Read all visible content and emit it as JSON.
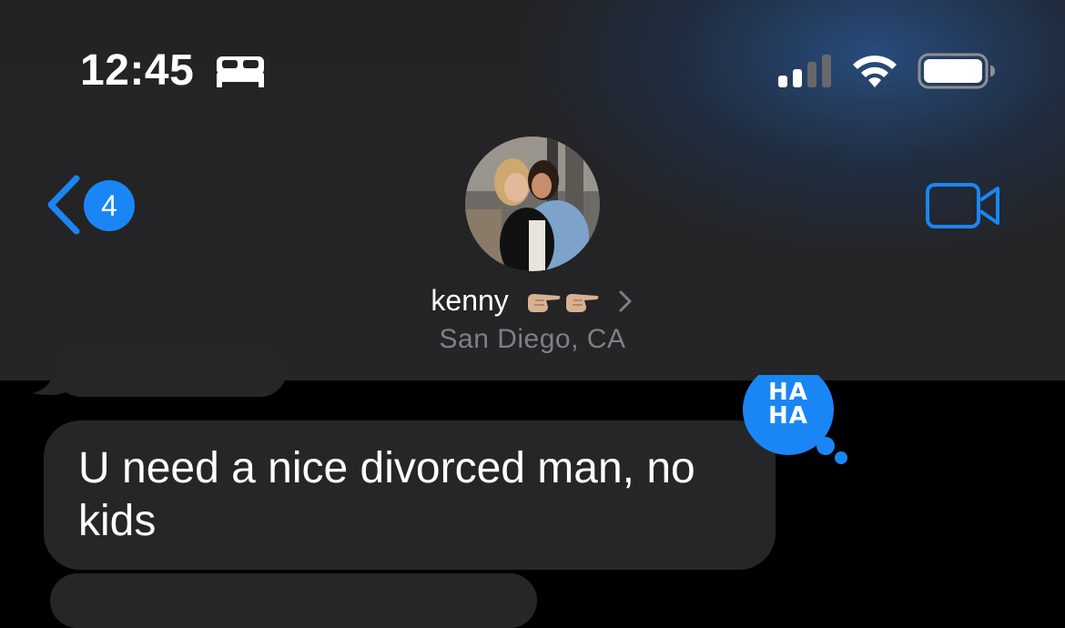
{
  "status_bar": {
    "time": "12:45",
    "focus_icon": "bed-icon",
    "signal_icon": "cellular-signal-icon",
    "signal_bars_active": 2,
    "signal_bars_total": 4,
    "wifi_icon": "wifi-icon",
    "battery_icon": "battery-icon"
  },
  "nav": {
    "back_icon": "chevron-left-icon",
    "back_badge_count": "4",
    "video_icon": "video-camera-icon",
    "accent_color": "#1a86f5"
  },
  "contact": {
    "name": "kenny",
    "name_emoji": "backhand-index-pointing-right-emoji ×2",
    "chevron_icon": "chevron-right-icon",
    "subtitle": "San Diego, CA"
  },
  "messages": [
    {
      "from": "contact",
      "text": ""
    },
    {
      "from": "contact",
      "text": "U need a nice divorced man, no kids",
      "tapback": "haha"
    },
    {
      "from": "contact",
      "text": ""
    }
  ],
  "tapback": {
    "label_line1": "HA",
    "label_line2": "HA",
    "color": "#1a86f5"
  },
  "colors": {
    "bubble_incoming": "#262629",
    "subtitle_gray": "#7f7f84",
    "background": "#000000"
  }
}
